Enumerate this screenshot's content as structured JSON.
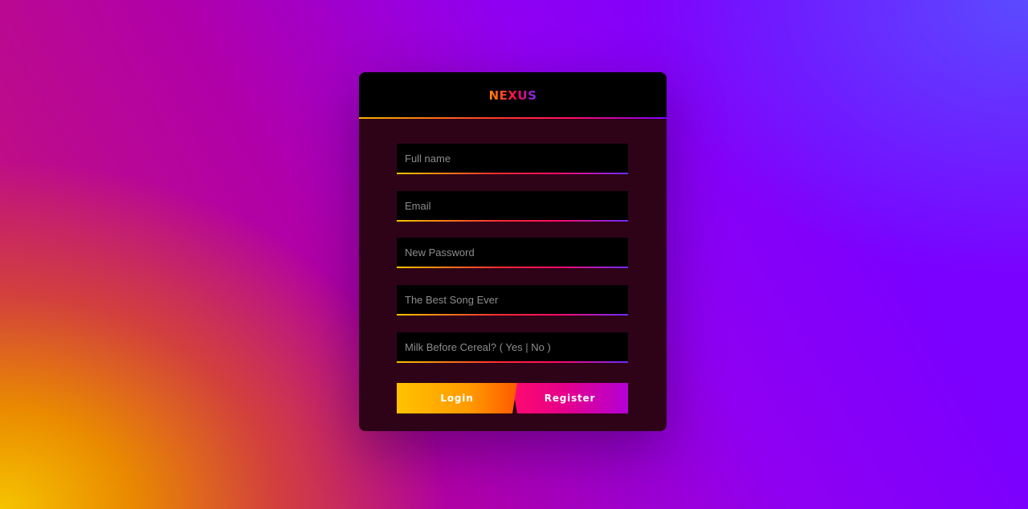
{
  "brand": {
    "logo_text": "NEXUS"
  },
  "form": {
    "fields": [
      {
        "name": "full-name",
        "placeholder": "Full name",
        "value": ""
      },
      {
        "name": "email",
        "placeholder": "Email",
        "value": ""
      },
      {
        "name": "new-password",
        "placeholder": "New Password",
        "value": ""
      },
      {
        "name": "best-song",
        "placeholder": "The Best Song Ever",
        "value": ""
      },
      {
        "name": "milk-before-cereal",
        "placeholder": "Milk Before Cereal? ( Yes | No )",
        "value": ""
      }
    ],
    "buttons": {
      "login_label": "Login",
      "register_label": "Register"
    }
  },
  "colors": {
    "card_background": "#2e0317",
    "header_background": "#000000",
    "field_background": "#000000",
    "accent_orange": "#ffa200",
    "accent_pink": "#ff0a6e",
    "accent_purple": "#7a00ff"
  }
}
